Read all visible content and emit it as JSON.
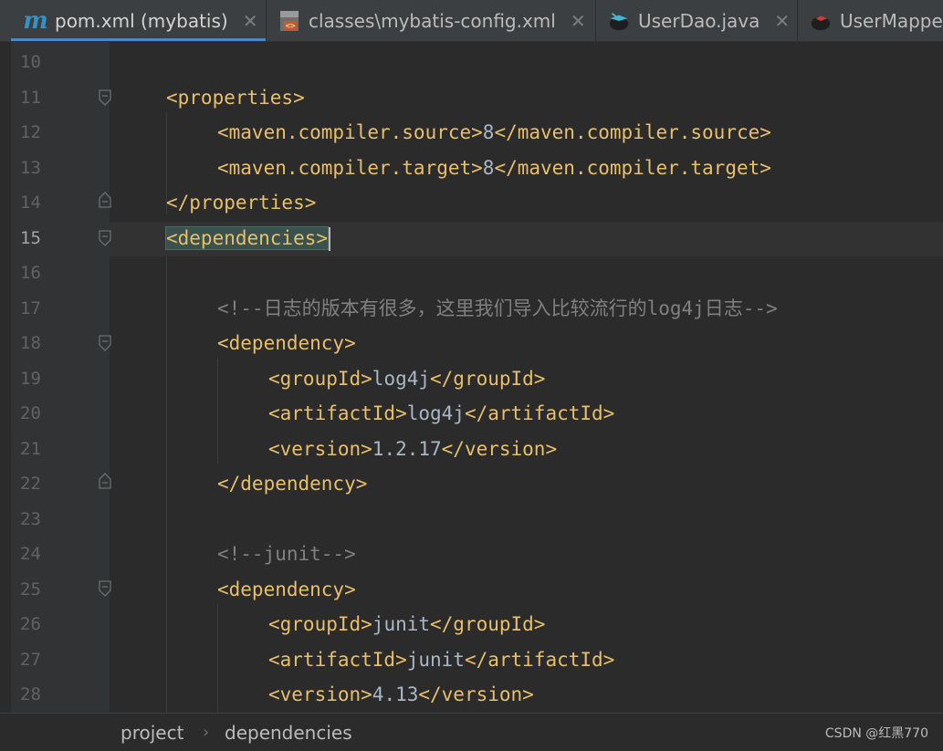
{
  "tabs": [
    {
      "label": "pom.xml (mybatis)",
      "icon": "maven-m-icon",
      "active": true
    },
    {
      "label": "classes\\mybatis-config.xml",
      "icon": "xml-file-icon",
      "active": false
    },
    {
      "label": "UserDao.java",
      "icon": "java-interface-icon",
      "active": false
    },
    {
      "label": "UserMappe",
      "icon": "java-mapper-icon",
      "active": false
    }
  ],
  "editor": {
    "current_line": "15",
    "lines": [
      {
        "num": "10",
        "parts": []
      },
      {
        "num": "11",
        "parts": [
          {
            "t": "tag",
            "v": "<properties>"
          }
        ]
      },
      {
        "num": "12",
        "parts": [
          {
            "t": "tag",
            "v": "<maven.compiler.source>"
          },
          {
            "t": "txt",
            "v": "8"
          },
          {
            "t": "tag",
            "v": "</maven.compiler.source>"
          }
        ]
      },
      {
        "num": "13",
        "parts": [
          {
            "t": "tag",
            "v": "<maven.compiler.target>"
          },
          {
            "t": "txt",
            "v": "8"
          },
          {
            "t": "tag",
            "v": "</maven.compiler.target>"
          }
        ]
      },
      {
        "num": "14",
        "parts": [
          {
            "t": "tag",
            "v": "</properties>"
          }
        ]
      },
      {
        "num": "15",
        "parts": [
          {
            "t": "tag",
            "v": "<dependencies>"
          }
        ]
      },
      {
        "num": "16",
        "parts": []
      },
      {
        "num": "17",
        "parts": [
          {
            "t": "cmt",
            "v": "<!--日志的版本有很多，这里我们导入比较流行的log4j日志-->"
          }
        ]
      },
      {
        "num": "18",
        "parts": [
          {
            "t": "tag",
            "v": "<dependency>"
          }
        ]
      },
      {
        "num": "19",
        "parts": [
          {
            "t": "tag",
            "v": "<groupId>"
          },
          {
            "t": "txt",
            "v": "log4j"
          },
          {
            "t": "tag",
            "v": "</groupId>"
          }
        ]
      },
      {
        "num": "20",
        "parts": [
          {
            "t": "tag",
            "v": "<artifactId>"
          },
          {
            "t": "txt",
            "v": "log4j"
          },
          {
            "t": "tag",
            "v": "</artifactId>"
          }
        ]
      },
      {
        "num": "21",
        "parts": [
          {
            "t": "tag",
            "v": "<version>"
          },
          {
            "t": "txt",
            "v": "1.2.17"
          },
          {
            "t": "tag",
            "v": "</version>"
          }
        ]
      },
      {
        "num": "22",
        "parts": [
          {
            "t": "tag",
            "v": "</dependency>"
          }
        ]
      },
      {
        "num": "23",
        "parts": []
      },
      {
        "num": "24",
        "parts": [
          {
            "t": "cmt",
            "v": "<!--junit-->"
          }
        ]
      },
      {
        "num": "25",
        "parts": [
          {
            "t": "tag",
            "v": "<dependency>"
          }
        ]
      },
      {
        "num": "26",
        "parts": [
          {
            "t": "tag",
            "v": "<groupId>"
          },
          {
            "t": "txt",
            "v": "junit"
          },
          {
            "t": "tag",
            "v": "</groupId>"
          }
        ]
      },
      {
        "num": "27",
        "parts": [
          {
            "t": "tag",
            "v": "<artifactId>"
          },
          {
            "t": "txt",
            "v": "junit"
          },
          {
            "t": "tag",
            "v": "</artifactId>"
          }
        ]
      },
      {
        "num": "28",
        "parts": [
          {
            "t": "tag",
            "v": "<version>"
          },
          {
            "t": "txt",
            "v": "4.13"
          },
          {
            "t": "tag",
            "v": "</version>"
          }
        ]
      }
    ]
  },
  "breadcrumb": {
    "items": [
      "project",
      "dependencies"
    ],
    "separator": "›"
  },
  "watermark": "CSDN @红黑770",
  "colors": {
    "tag": "#e8bf6a",
    "text": "#a9b7c6",
    "comment": "#808080",
    "accent": "#4a88c7"
  }
}
